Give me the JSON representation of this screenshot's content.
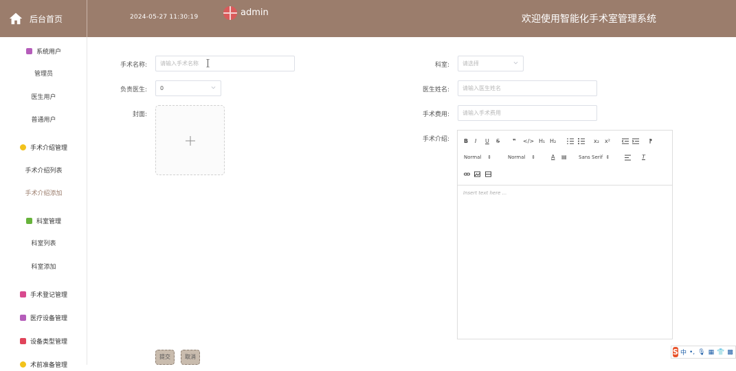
{
  "header": {
    "home_label": "后台首页",
    "datetime": "2024-05-27 11:30:19",
    "username": "admin",
    "system_title": "欢迎使用智能化手术室管理系统",
    "bg_color": "#9b7d6c"
  },
  "sidebar": {
    "groups": [
      {
        "label": "系统用户",
        "icon": "archive-icon",
        "color": "#b55dba"
      },
      {
        "label": "手术介绍管理",
        "icon": "flower-icon",
        "color": "#f2c21b"
      },
      {
        "label": "科室管理",
        "icon": "chat-icon",
        "color": "#67b33b"
      },
      {
        "label": "手术登记管理",
        "icon": "clipboard-icon",
        "color": "#d84a8e"
      },
      {
        "label": "医疗设备管理",
        "icon": "archive-icon",
        "color": "#b55dba"
      },
      {
        "label": "设备类型管理",
        "icon": "grid-icon",
        "color": "#e0445a"
      },
      {
        "label": "术前准备管理",
        "icon": "flower-icon",
        "color": "#f2c21b"
      }
    ],
    "items": [
      {
        "label": "管理员"
      },
      {
        "label": "医生用户"
      },
      {
        "label": "普通用户"
      },
      {
        "label": "手术介绍列表"
      },
      {
        "label": "手术介绍添加"
      },
      {
        "label": "科室列表"
      },
      {
        "label": "科室添加"
      }
    ]
  },
  "form": {
    "surgery_name": {
      "label": "手术名称:",
      "placeholder": "请输入手术名称"
    },
    "doctor_in_charge": {
      "label": "负责医生:",
      "value": "0"
    },
    "cover": {
      "label": "封面:"
    },
    "department": {
      "label": "科室:",
      "placeholder": "请选择"
    },
    "doctor_name": {
      "label": "医生姓名:",
      "placeholder": "请输入医生姓名"
    },
    "surgery_fee": {
      "label": "手术费用:",
      "placeholder": "请输入手术费用"
    },
    "surgery_intro": {
      "label": "手术介绍:",
      "placeholder": "Insert text here ..."
    },
    "submit_label": "提交",
    "cancel_label": "取消"
  },
  "editor_toolbar": {
    "header1": "H₁",
    "header2": "H₂",
    "sub": "x₂",
    "sup": "x²",
    "size_picker": "Normal",
    "header_picker": "Normal",
    "font_picker": "Sans Serif"
  },
  "ime": {
    "logo": "S",
    "lang": "中"
  }
}
